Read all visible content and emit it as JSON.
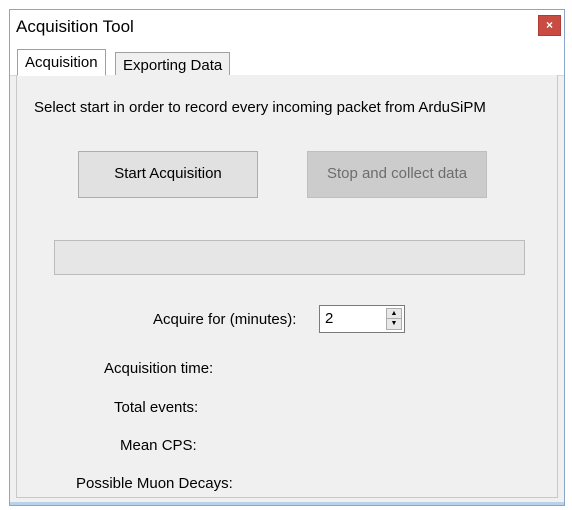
{
  "window": {
    "title": "Acquisition Tool",
    "close_glyph": "×",
    "accent_color": "#c94c42"
  },
  "tabs": [
    {
      "label": "Acquisition",
      "active": true
    },
    {
      "label": "Exporting Data",
      "active": false
    }
  ],
  "panel": {
    "instructions": "Select start in order to record every incoming packet from ArduSiPM",
    "start_button": "Start Acquisition",
    "stop_button": "Stop and collect data",
    "progress_value": 0,
    "acquire_label": "Acquire for (minutes):",
    "acquire_value": "2",
    "spin_up_icon": "▲",
    "spin_down_icon": "▼",
    "stats": {
      "acquisition_time": "Acquisition time:",
      "total_events": "Total events:",
      "mean_cps": "Mean CPS:",
      "muon_decays": "Possible Muon Decays:"
    }
  }
}
